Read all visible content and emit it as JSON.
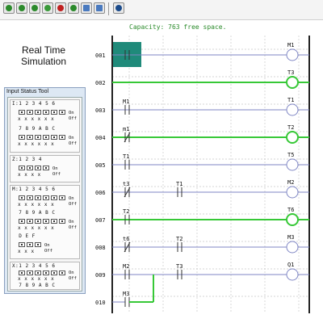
{
  "toolbar": {
    "buttons": [
      {
        "icon": "stop-icon",
        "color": "#2b8a2b"
      },
      {
        "icon": "run-icon",
        "color": "#2b8a2b"
      },
      {
        "icon": "step-icon",
        "color": "#2b8a2b"
      },
      {
        "icon": "mode-icon",
        "color": "#3a9a3a"
      },
      {
        "icon": "record-icon",
        "color": "#c02020"
      },
      {
        "icon": "scan-icon",
        "color": "#2b8a2b"
      },
      {
        "icon": "table-icon",
        "color": "#4a7abf"
      },
      {
        "icon": "list-icon",
        "color": "#4a7abf"
      },
      {
        "icon": "display-icon",
        "color": "#1a4a8a"
      }
    ]
  },
  "capacity": "Capacity: 763 free space.",
  "simulation": {
    "title_line1": "Real Time",
    "title_line2": "Simulation"
  },
  "input_status_tool": {
    "title": "Input Status Tool",
    "groups": [
      {
        "rows": [
          {
            "header": "I:1 2 3 4 5 6",
            "values": "x x x x x x",
            "on": "On",
            "off": "Off"
          },
          {
            "header": "  7 8 9 A B C",
            "values": "x x x x x x",
            "on": "On",
            "off": "Off"
          }
        ]
      },
      {
        "rows": [
          {
            "header": "Z:1 2 3 4",
            "values": "x x x x",
            "on": "On",
            "off": "Off"
          }
        ]
      },
      {
        "rows": [
          {
            "header": "M:1 2 3 4 5 6",
            "values": "x x x x x x",
            "on": "On",
            "off": "Off"
          },
          {
            "header": "  7 8 9 A B C",
            "values": "x x x x x x",
            "on": "On",
            "off": "Off"
          },
          {
            "header": "  D E F",
            "values": "x x x",
            "on": "On",
            "off": "Off"
          }
        ]
      },
      {
        "rows": [
          {
            "header": "X:1 2 3 4 5 6",
            "values": "x x x x x x",
            "on": "On",
            "off": "Off"
          },
          {
            "header": "  7 8 9 A B C",
            "values": "x x x x x x",
            "on": "On",
            "off": "Off"
          }
        ]
      }
    ]
  },
  "ladder": {
    "rungs": [
      {
        "number": "001",
        "contact1": "",
        "contact2": "",
        "coil": "M1",
        "active": false
      },
      {
        "number": "002",
        "contact1": "",
        "contact2": "",
        "coil": "T3",
        "active": true
      },
      {
        "number": "003",
        "contact1": "M1",
        "contact2": "",
        "coil": "T1",
        "active": false
      },
      {
        "number": "004",
        "contact1": "m1",
        "contact2": "",
        "coil": "T2",
        "active": true
      },
      {
        "number": "005",
        "contact1": "T1",
        "contact2": "",
        "coil": "T5",
        "active": false
      },
      {
        "number": "006",
        "contact1": "t3",
        "contact2": "T1",
        "coil": "M2",
        "active": false
      },
      {
        "number": "007",
        "contact1": "T2",
        "contact2": "",
        "coil": "T6",
        "active": true
      },
      {
        "number": "008",
        "contact1": "t6",
        "contact2": "T2",
        "coil": "M3",
        "active": false
      },
      {
        "number": "009",
        "contact1": "M2",
        "contact2": "T3",
        "coil": "Q1",
        "active": false
      },
      {
        "number": "010",
        "contact1": "M3",
        "contact2": "",
        "coil": "",
        "active": false
      }
    ],
    "colors": {
      "energized": "#37c837",
      "idle": "#7f86c4",
      "selection": "#1f8a7a",
      "grid": "#c8c8c8"
    }
  }
}
